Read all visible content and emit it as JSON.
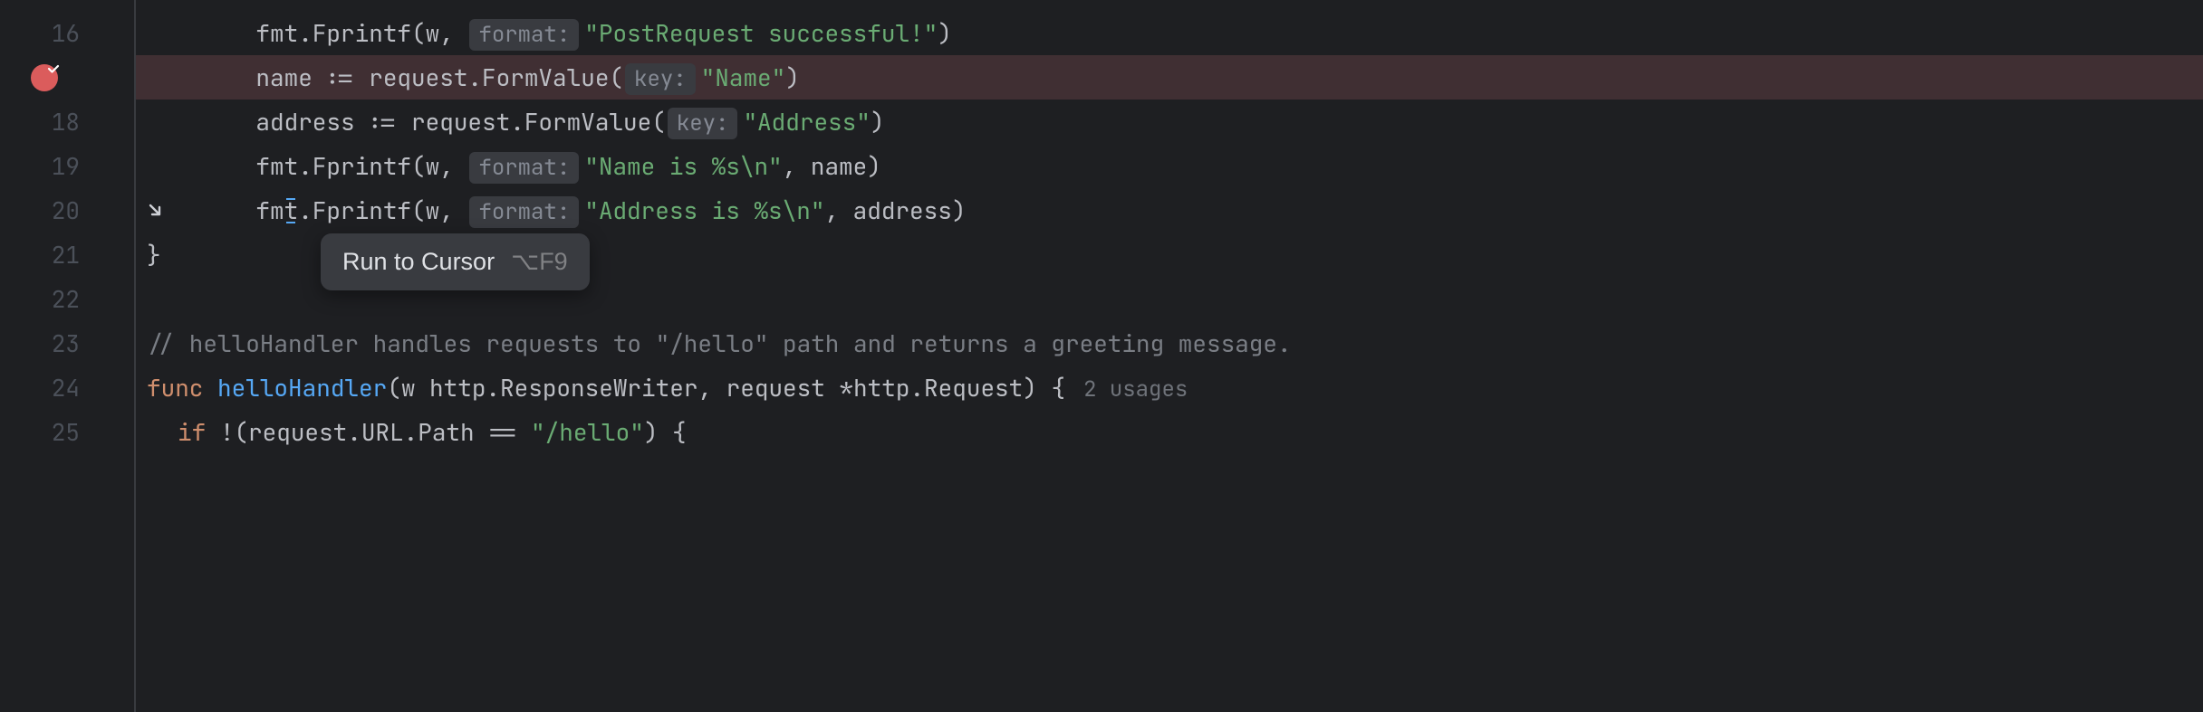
{
  "gutter": {
    "lines": [
      "16",
      "",
      "18",
      "19",
      "20",
      "21",
      "22",
      "23",
      "24",
      "25"
    ],
    "breakpoint_line_index": 1
  },
  "tooltip": {
    "label": "Run to Cursor",
    "shortcut": "⌥F9"
  },
  "code": {
    "l16": {
      "ident1": "fmt",
      "func": "Fprintf",
      "args_open": "(w, ",
      "hint": "format:",
      "str": "\"PostRequest successful!\"",
      "close": ")"
    },
    "l17": {
      "lhs": "name ",
      "op": ":=",
      "rhs1": " request.",
      "func": "FormValue",
      "open": "(",
      "hint": "key:",
      "str": "\"Name\"",
      "close": ")"
    },
    "l18": {
      "lhs": "address ",
      "op": ":=",
      "rhs1": " request.",
      "func": "FormValue",
      "open": "(",
      "hint": "key:",
      "str": "\"Address\"",
      "close": ")"
    },
    "l19": {
      "ident1": "fmt",
      "func": "Fprintf",
      "args_open": "(w, ",
      "hint": "format:",
      "str": "\"Name is %s\\n\"",
      "rest": ", name)"
    },
    "l20": {
      "ident1": "fmt",
      "func": "Fprintf",
      "args_open": "(w, ",
      "hint": "format:",
      "str": "\"Address is %s\\n\"",
      "rest": ", address)"
    },
    "l21": {
      "brace": "}"
    },
    "l23": {
      "comment": "// helloHandler handles requests to \"/hello\" path and returns a greeting message."
    },
    "l24": {
      "kw": "func ",
      "name": "helloHandler",
      "sig1": "(w http.",
      "type1": "ResponseWriter",
      "sig2": ", request *http.",
      "type2": "Request",
      "sig3": ") {",
      "usages": "2 usages"
    },
    "l25": {
      "kw": "if ",
      "cond1": "!(request.URL.Path == ",
      "str": "\"/hello\"",
      "cond2": ") {"
    }
  }
}
